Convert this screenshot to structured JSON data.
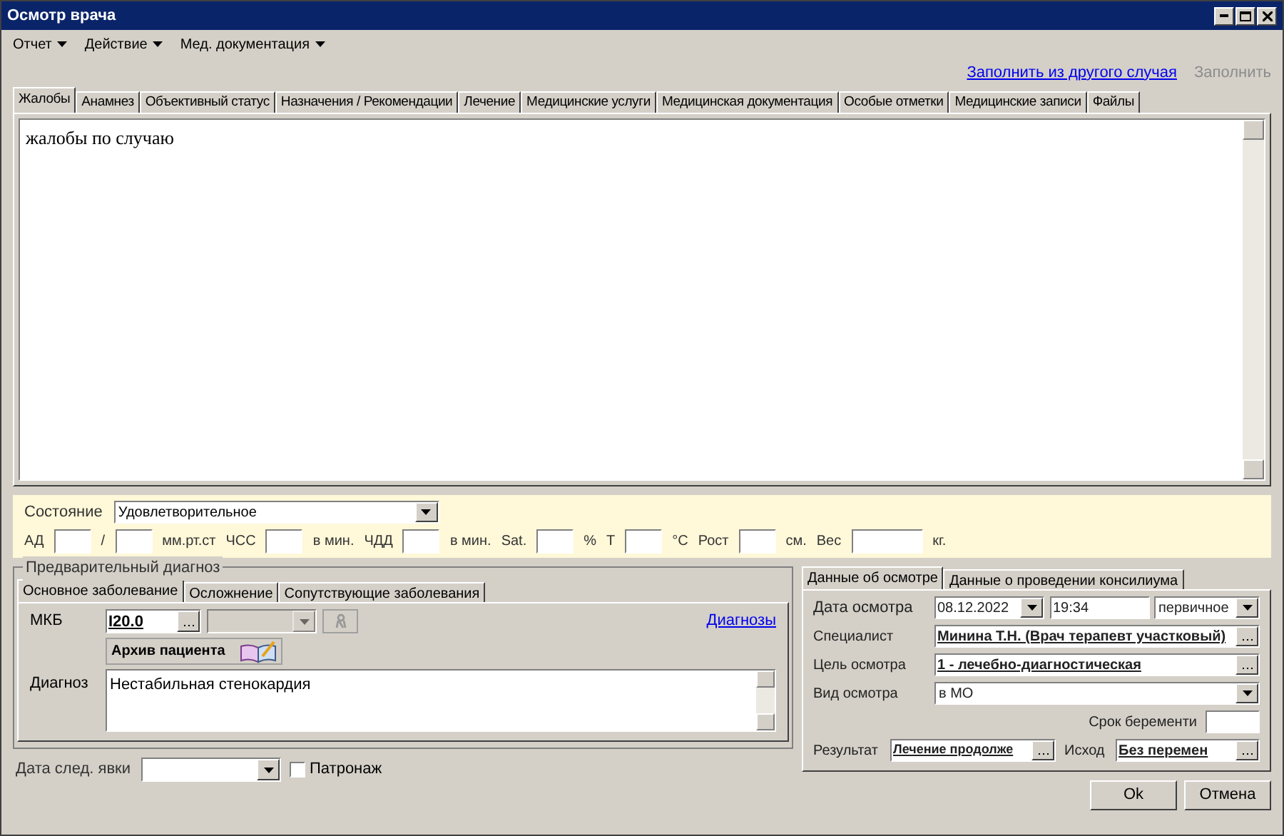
{
  "window": {
    "title": "Осмотр врача"
  },
  "menu": [
    {
      "label": "Отчет"
    },
    {
      "label": "Действие"
    },
    {
      "label": "Мед. документация"
    }
  ],
  "toolbar_links": [
    {
      "label": "Заполнить из другого случая",
      "disabled": false
    },
    {
      "label": "Заполнить",
      "disabled": true
    }
  ],
  "tabs": [
    {
      "label": "Жалобы",
      "selected": true
    },
    {
      "label": "Анамнез",
      "selected": false
    },
    {
      "label": "Объективный статус",
      "selected": false
    },
    {
      "label": "Назначения / Рекомендации",
      "selected": false
    },
    {
      "label": "Лечение",
      "selected": false
    },
    {
      "label": "Медицинские услуги",
      "selected": false
    },
    {
      "label": "Медицинская документация",
      "selected": false
    },
    {
      "label": "Особые отметки",
      "selected": false
    },
    {
      "label": "Медицинские записи",
      "selected": false
    },
    {
      "label": "Файлы",
      "selected": false
    }
  ],
  "complaints_text": "жалобы по случаю",
  "vitals": {
    "state_label": "Состояние",
    "state_value": "Удовлетворительное",
    "items": [
      {
        "kind": "label",
        "text": "АД"
      },
      {
        "kind": "field"
      },
      {
        "kind": "label",
        "text": "/"
      },
      {
        "kind": "field"
      },
      {
        "kind": "label",
        "text": "мм.рт.ст"
      },
      {
        "kind": "label",
        "text": "ЧСС"
      },
      {
        "kind": "field"
      },
      {
        "kind": "label",
        "text": "в мин."
      },
      {
        "kind": "label",
        "text": "ЧДД"
      },
      {
        "kind": "field"
      },
      {
        "kind": "label",
        "text": "в мин."
      },
      {
        "kind": "label",
        "text": "Sat."
      },
      {
        "kind": "field"
      },
      {
        "kind": "label",
        "text": "%"
      },
      {
        "kind": "label",
        "text": "Т"
      },
      {
        "kind": "field"
      },
      {
        "kind": "label",
        "text": "°С"
      },
      {
        "kind": "label",
        "text": "Рост"
      },
      {
        "kind": "field"
      },
      {
        "kind": "label",
        "text": "см."
      },
      {
        "kind": "label",
        "text": "Вес"
      },
      {
        "kind": "wide_field"
      },
      {
        "kind": "label",
        "text": "кг."
      }
    ]
  },
  "diagnosis": {
    "title": "Предварительный диагноз",
    "tabs": [
      {
        "label": "Основное заболевание",
        "selected": true
      },
      {
        "label": "Осложнение",
        "selected": false
      },
      {
        "label": "Сопутствующие заболевания",
        "selected": false
      }
    ],
    "mkb_label": "МКБ",
    "mkb_value": "I20.0",
    "diagnoses_link": "Диагнозы",
    "archive_button": "Архив пациента",
    "diagnosis_label": "Диагноз",
    "diagnosis_text": "Нестабильная стенокардия"
  },
  "next_visit": {
    "label": "Дата след. явки",
    "patronage": {
      "label": "Патронаж",
      "checked": false
    }
  },
  "exam": {
    "tabs": [
      {
        "label": "Данные об осмотре",
        "selected": true
      },
      {
        "label": "Данные о проведении консилиума",
        "selected": false
      }
    ],
    "date_label": "Дата осмотра",
    "date": "08.12.2022",
    "time": "19:34",
    "visit_type": "первичное",
    "specialist_label": "Специалист",
    "specialist": "Минина Т.Н. (Врач терапевт участковый)",
    "goal_label": "Цель осмотра",
    "goal": "1 - лечебно-диагностическая",
    "kind_label": "Вид осмотра",
    "kind_value": "в МО",
    "pregnancy_label": "Срок беременти",
    "result_label": "Результат",
    "result": "Лечение продолже",
    "outcome_label": "Исход",
    "outcome": "Без перемен"
  },
  "buttons": [
    {
      "label": "Ok"
    },
    {
      "label": "Отмена"
    }
  ]
}
